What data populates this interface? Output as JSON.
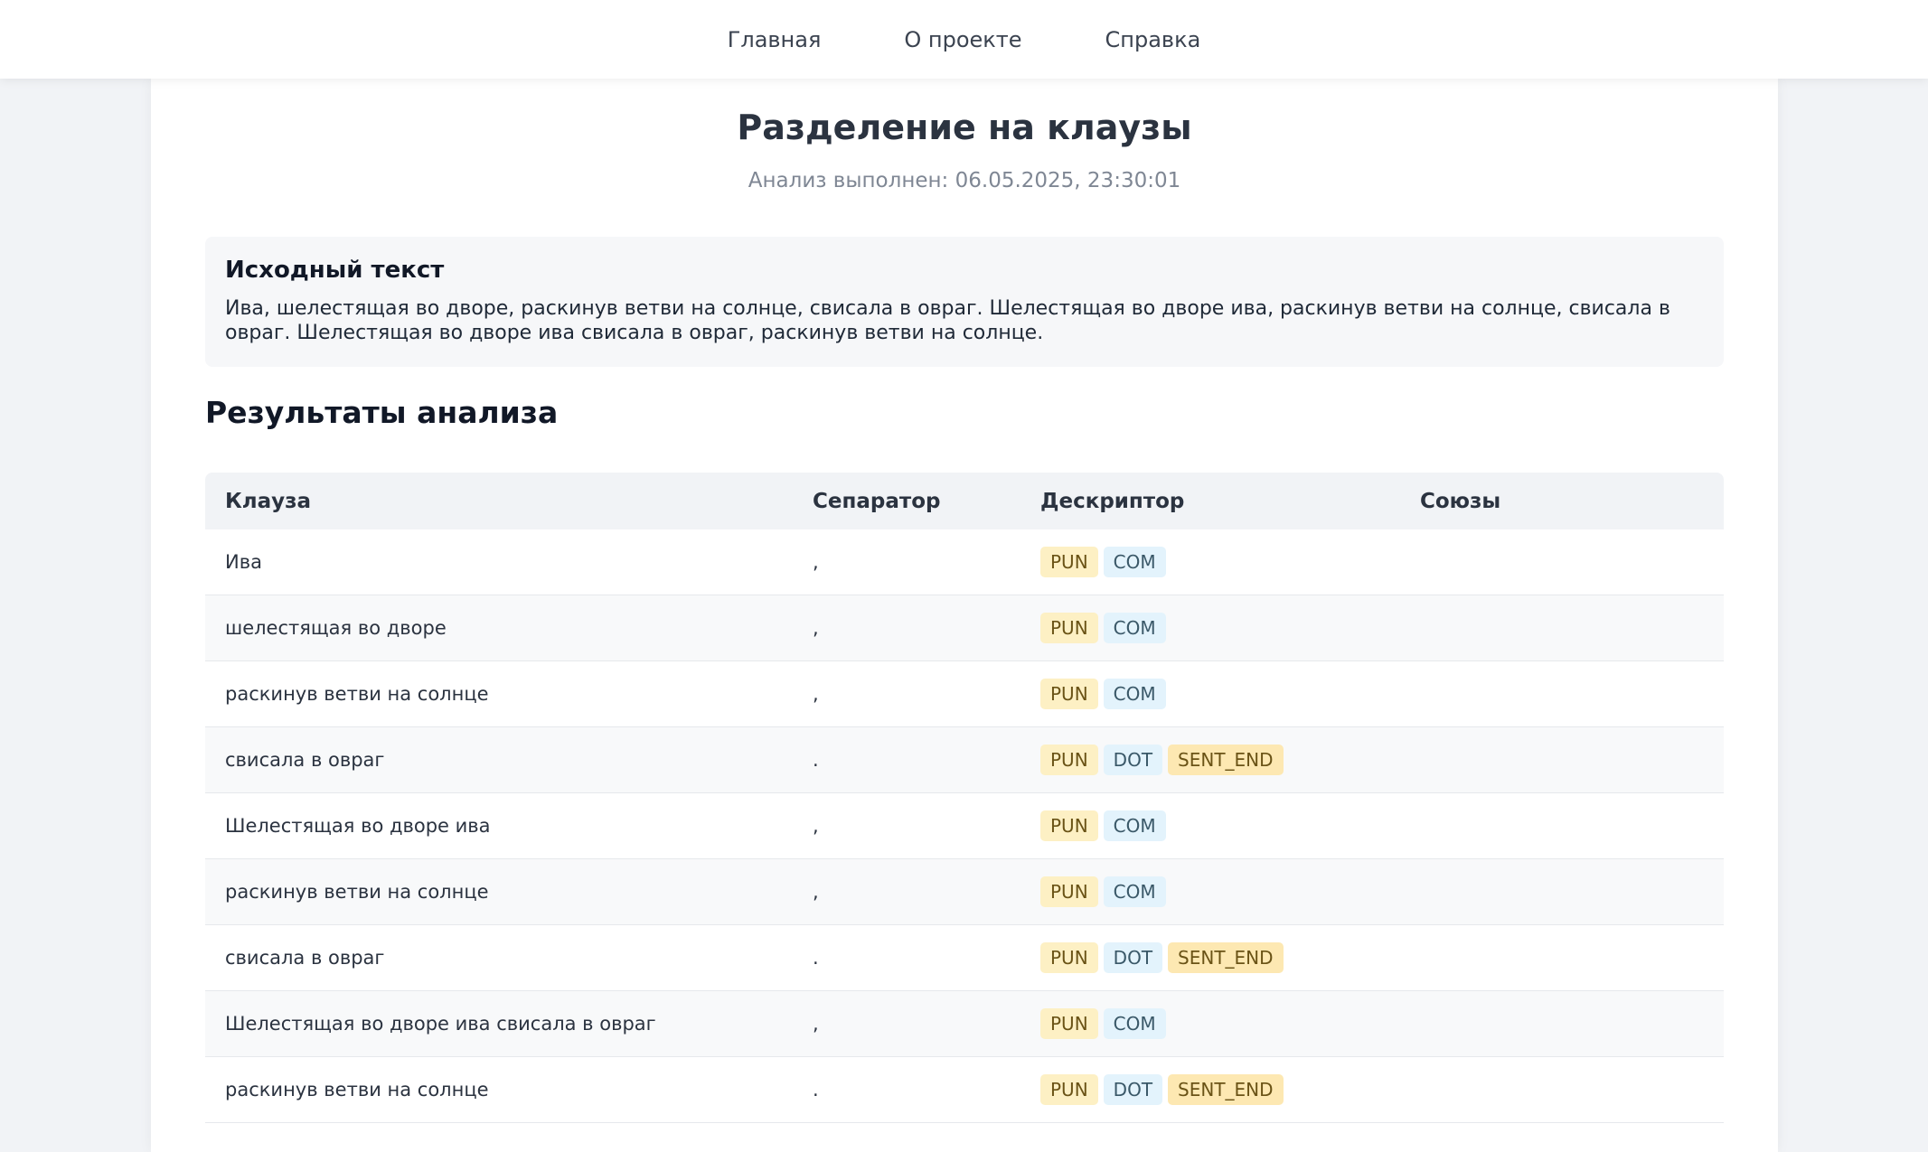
{
  "nav": {
    "items": [
      {
        "label": "Главная"
      },
      {
        "label": "О проекте"
      },
      {
        "label": "Справка"
      }
    ]
  },
  "page": {
    "title": "Разделение на клаузы",
    "timestamp": "Анализ выполнен: 06.05.2025, 23:30:01"
  },
  "source": {
    "heading": "Исходный текст",
    "text": "Ива, шелестящая во дворе, раскинув ветви на солнце, свисала в овраг. Шелестящая во дворе ива, раскинув ветви на солнце, свисала в овраг. Шелестящая во дворе ива свисала в овраг, раскинув ветви на солнце."
  },
  "results": {
    "heading": "Результаты анализа",
    "columns": [
      "Клауза",
      "Сепаратор",
      "Дескриптор",
      "Союзы"
    ],
    "rows": [
      {
        "clause": "Ива",
        "separator": ",",
        "tags": [
          "PUN",
          "COM"
        ],
        "conjunctions": ""
      },
      {
        "clause": "шелестящая во дворе",
        "separator": ",",
        "tags": [
          "PUN",
          "COM"
        ],
        "conjunctions": ""
      },
      {
        "clause": "раскинув ветви на солнце",
        "separator": ",",
        "tags": [
          "PUN",
          "COM"
        ],
        "conjunctions": ""
      },
      {
        "clause": "свисала в овраг",
        "separator": ".",
        "tags": [
          "PUN",
          "DOT",
          "SENT_END"
        ],
        "conjunctions": ""
      },
      {
        "clause": "Шелестящая во дворе ива",
        "separator": ",",
        "tags": [
          "PUN",
          "COM"
        ],
        "conjunctions": ""
      },
      {
        "clause": "раскинув ветви на солнце",
        "separator": ",",
        "tags": [
          "PUN",
          "COM"
        ],
        "conjunctions": ""
      },
      {
        "clause": "свисала в овраг",
        "separator": ".",
        "tags": [
          "PUN",
          "DOT",
          "SENT_END"
        ],
        "conjunctions": ""
      },
      {
        "clause": "Шелестящая во дворе ива свисала в овраг",
        "separator": ",",
        "tags": [
          "PUN",
          "COM"
        ],
        "conjunctions": ""
      },
      {
        "clause": "раскинув ветви на солнце",
        "separator": ".",
        "tags": [
          "PUN",
          "DOT",
          "SENT_END"
        ],
        "conjunctions": ""
      }
    ]
  },
  "colors": {
    "tag_pun": "#fdf0c4",
    "tag_com": "#e3f3fc",
    "tag_sent_end": "#fde8b2"
  }
}
